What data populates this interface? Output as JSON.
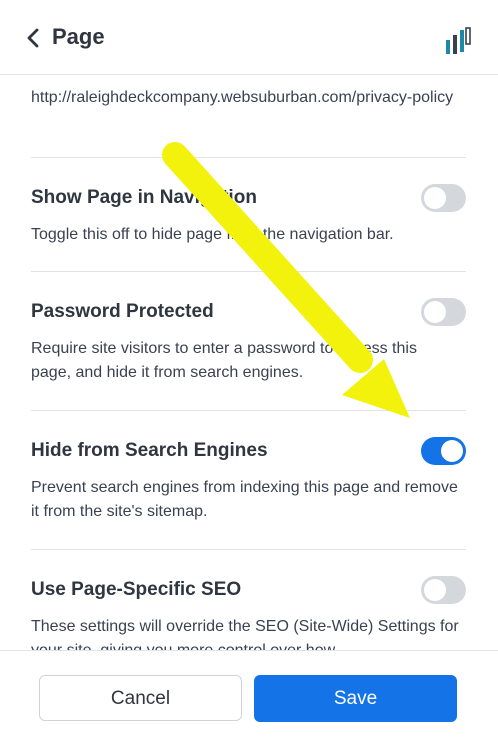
{
  "header": {
    "title": "Page",
    "back_icon": "chevron-left-icon",
    "brand_icon": "bar-chart-logo-icon"
  },
  "url_text": "http://raleighdeckcompany.websuburban.com/privacy-policy",
  "settings": [
    {
      "title": "Show Page in Navigation",
      "description": "Toggle this off to hide page from the navigation bar.",
      "enabled": false
    },
    {
      "title": "Password Protected",
      "description": "Require site visitors to enter a password to access this page, and hide it from search engines.",
      "enabled": false
    },
    {
      "title": "Hide from Search Engines",
      "description": "Prevent search engines from indexing this page and remove it from the site's sitemap.",
      "enabled": true
    },
    {
      "title": "Use Page-Specific SEO",
      "description": "These settings will override the SEO (Site-Wide) Settings for your site, giving you more control over how",
      "enabled": false
    }
  ],
  "footer": {
    "cancel_label": "Cancel",
    "save_label": "Save"
  },
  "colors": {
    "accent": "#1473e6",
    "toggle_off": "#d4d7dc",
    "annotation_arrow": "#f2f20c"
  }
}
